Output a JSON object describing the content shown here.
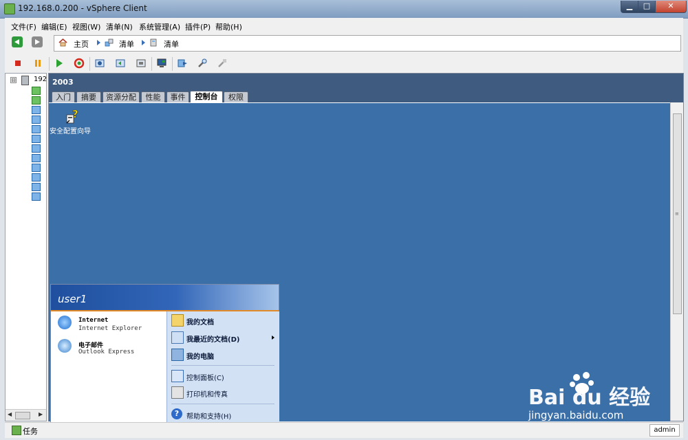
{
  "window": {
    "title": "192.168.0.200 - vSphere Client",
    "min": "▁",
    "max": "□",
    "close": "✕"
  },
  "menubar": {
    "items": [
      "文件(F)",
      "编辑(E)",
      "视图(W)",
      "清单(N)",
      "系统管理(A)",
      "插件(P)",
      "帮助(H)"
    ]
  },
  "navigation": {
    "breadcrumb": [
      "主页",
      "清单",
      "清单"
    ]
  },
  "tree": {
    "expander": "⊟",
    "host_label": "192",
    "vm_count": 12
  },
  "vm_panel": {
    "title": "2003",
    "tabs": [
      "入门",
      "摘要",
      "资源分配",
      "性能",
      "事件",
      "控制台",
      "权限"
    ],
    "active_tab": "控制台"
  },
  "desktop": {
    "icon_label": "安全配置向导"
  },
  "start_menu": {
    "user": "user1",
    "pinned": [
      {
        "title": "Internet",
        "subtitle": "Internet Explorer",
        "icon": "ie-icon"
      },
      {
        "title": "电子邮件",
        "subtitle": "Outlook Express",
        "icon": "mail-icon"
      }
    ],
    "places": [
      {
        "label": "我的文档",
        "icon": "folder-icon"
      },
      {
        "label": "我最近的文档(D)",
        "icon": "recent-docs-icon",
        "submenu": true
      },
      {
        "label": "我的电脑",
        "icon": "my-computer-icon"
      }
    ],
    "system": [
      {
        "label": "控制面板(C)",
        "icon": "control-panel-icon"
      },
      {
        "label": "打印机和传真",
        "icon": "printer-icon"
      }
    ],
    "help": {
      "label": "帮助和支持(H)",
      "icon": "help-icon"
    }
  },
  "statusbar": {
    "tasks_label": "任务",
    "user": "admin"
  },
  "watermark": {
    "brand": "Bai du 经验",
    "url": "jingyan.baidu.com"
  },
  "colors": {
    "console_bg": "#3b6fa8",
    "panel_header": "#3f5b7f",
    "start_header": "#1f4f9e",
    "start_accent": "#e38a27"
  }
}
